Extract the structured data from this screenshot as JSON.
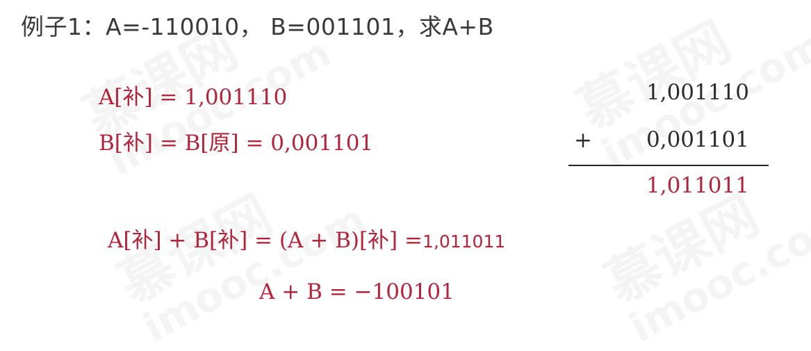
{
  "heading": "例子1：A=-110010， B=001101，求A+B",
  "equations": {
    "a_comp": "A[补] = 1,001110",
    "b_comp": "B[补] = B[原] = 0,001101",
    "sum_lhs": "A[补] + B[补] = (A + B)[补] =",
    "sum_rhs": "1,011011",
    "result": "A + B = −100101"
  },
  "addition": {
    "operand1": "1,001110",
    "operator": "+",
    "operand2": "0,001101",
    "sum": "1,011011"
  },
  "watermark": {
    "text_cn": "慕课网",
    "text_en": "imooc.com"
  },
  "colors": {
    "heading": "#3a3a3a",
    "equation_red": "#b3243a",
    "operand_black": "#2b2b2b",
    "rule": "#222222"
  }
}
